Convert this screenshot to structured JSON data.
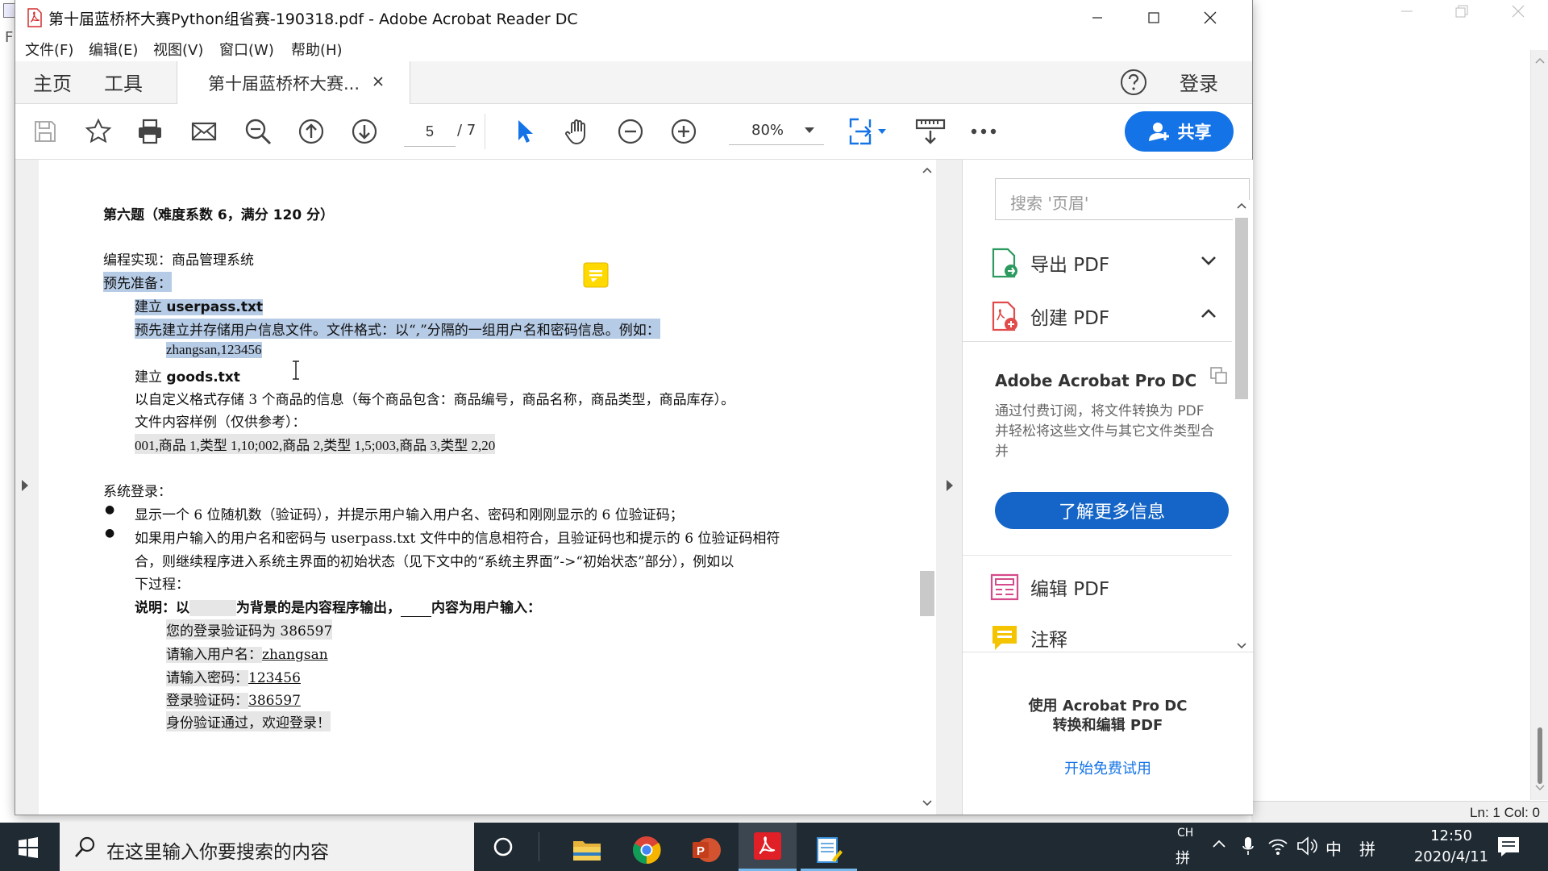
{
  "background_app": {
    "side_label": "F",
    "status": "Ln: 1   Col: 0"
  },
  "window": {
    "title": "第十届蓝桥杯大赛Python组省赛-190318.pdf - Adobe Acrobat Reader DC"
  },
  "menu": [
    "文件(F)",
    "编辑(E)",
    "视图(V)",
    "窗口(W)",
    "帮助(H)"
  ],
  "tabs": {
    "home": "主页",
    "tools": "工具",
    "document": "第十届蓝桥杯大赛...",
    "login": "登录"
  },
  "toolbar": {
    "page_current": "5",
    "page_total": "/ 7",
    "zoom": "80%",
    "share": "共享"
  },
  "document": {
    "heading": "第六题（难度系数 6，满分 120 分）",
    "l1": "编程实现：商品管理系统",
    "l2": "预先准备：",
    "l3a": "建立 ",
    "l3b": "userpass.txt",
    "l4": "预先建立并存储用户信息文件。文件格式：以“,”分隔的一组用户名和密码信息。例如：",
    "l5": "zhangsan,123456",
    "l6a": "建立 ",
    "l6b": "goods.txt",
    "l7": "以自定义格式存储 3 个商品的信息（每个商品包含：商品编号，商品名称，商品类型，商品库存）。",
    "l8": "文件内容样例（仅供参考）：",
    "l9": "001,商品 1,类型 1,10;002,商品 2,类型 1,5;003,商品 3,类型 2,20",
    "l10": "系统登录：",
    "b1": "显示一个 6 位随机数（验证码），并提示用户输入用户名、密码和刚刚显示的 6 位验证码；",
    "b2a": "如果用户输入的用户名和密码与 userpass.txt 文件中的信息相符合，且验证码也和提示的 6 位验证码相符",
    "b2b": "合，则继续程序进入系统主界面的初始状态（见下文中的“系统主界面”->“初始状态”部分），例如以",
    "b2c": "下过程：",
    "note_a": "说明：以",
    "note_b": "为背景的是内容程序输出，",
    "note_c": "内容为用户输入：",
    "e1": "您的登录验证码为 386597",
    "e2a": "请输入用户名：",
    "e2b": "zhangsan",
    "e3a": "请输入密码：",
    "e3b": "123456",
    "e4a": "登录验证码：",
    "e4b": "386597",
    "e5": "身份验证通过，欢迎登录！"
  },
  "right_panel": {
    "search_placeholder": "搜索 '页眉'",
    "export_pdf": "导出 PDF",
    "create_pdf": "创建 PDF",
    "promo_title": "Adobe Acrobat Pro DC",
    "promo_desc": "通过付费订阅，将文件转换为 PDF 并轻松将这些文件与其它文件类型合并",
    "learn_more": "了解更多信息",
    "edit_pdf": "编辑 PDF",
    "comment": "注释",
    "footer_line1": "使用 Acrobat Pro DC",
    "footer_line2": "转换和编辑 PDF",
    "trial": "开始免费试用"
  },
  "taskbar": {
    "search_text": "在这里输入你要搜索的内容",
    "ime_top": "CH",
    "ime_bottom": "拼",
    "lang": "中",
    "ime2": "拼",
    "time": "12:50",
    "date": "2020/4/11"
  },
  "colors": {
    "accent": "#1473e6",
    "highlight": "#b6cbe6",
    "taskbar": "#1f2a33"
  }
}
